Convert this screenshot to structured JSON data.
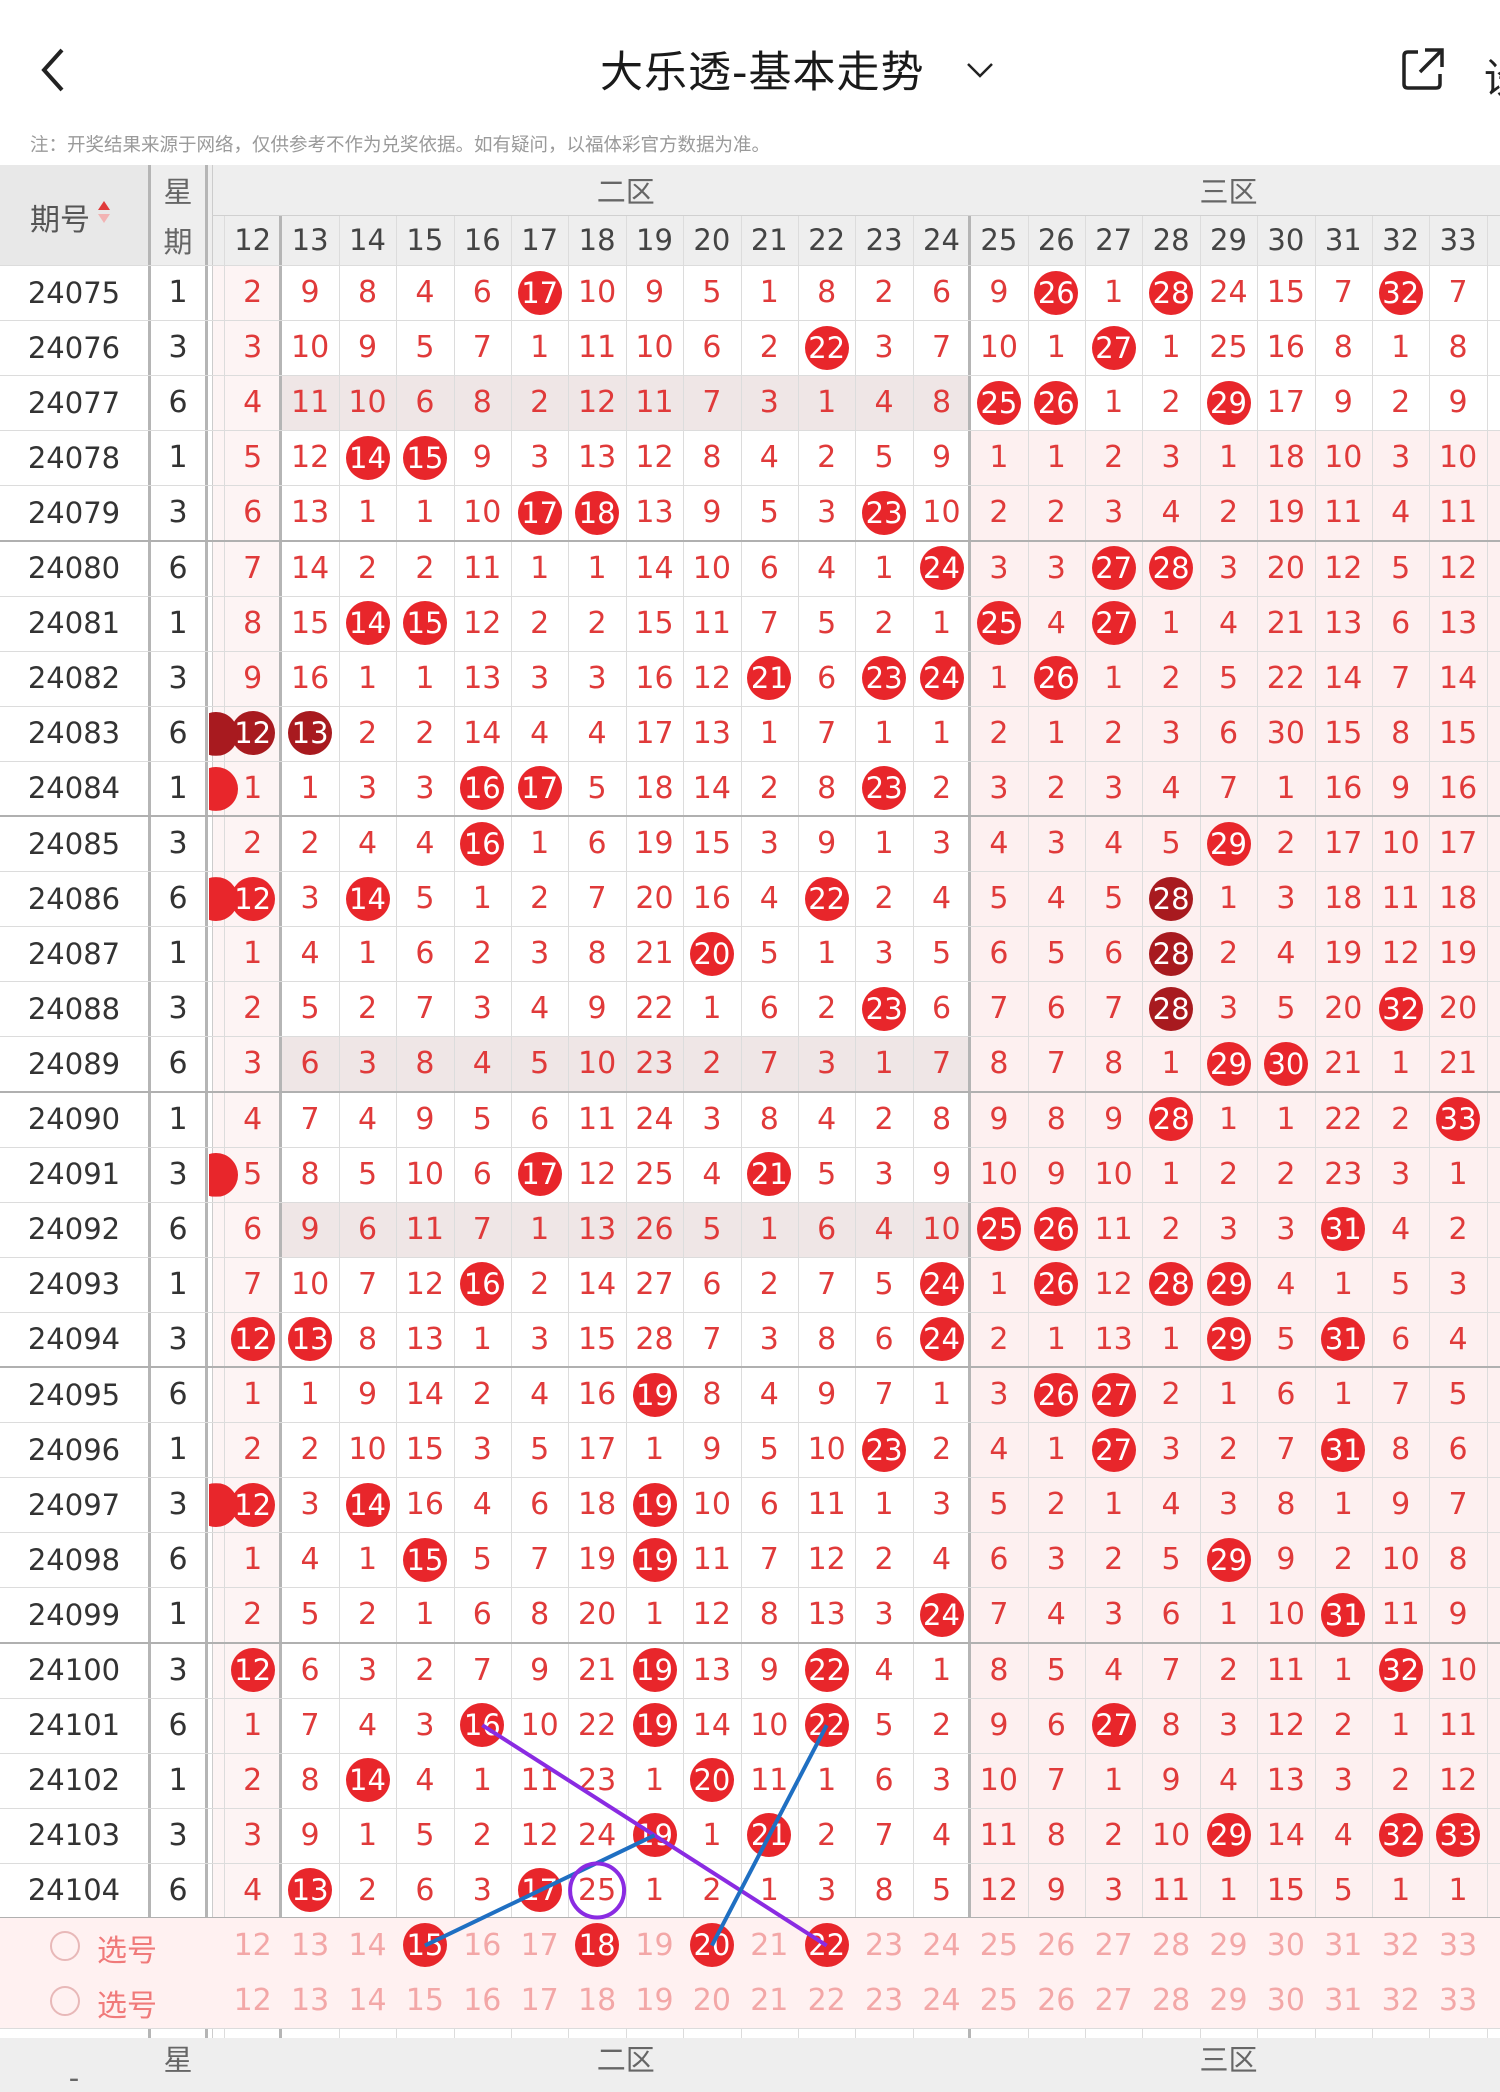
{
  "header": {
    "title": "大乐透-基本走势",
    "cut_text": "设"
  },
  "notice": "注：开奖结果来源于网络，仅供参考不作为兑奖依据。如有疑问，以福体彩官方数据为准。",
  "table": {
    "issue_header": "期号",
    "week_header_top": "星",
    "week_header_bottom": "期",
    "zone_two": "二区",
    "zone_three": "三区",
    "columns": [
      "12",
      "13",
      "14",
      "15",
      "16",
      "17",
      "18",
      "19",
      "20",
      "21",
      "22",
      "23",
      "24",
      "25",
      "26",
      "27",
      "28",
      "29",
      "30",
      "31",
      "32",
      "33"
    ],
    "rows": [
      {
        "issue": "24075",
        "week": "1",
        "vals": [
          "2",
          "9",
          "8",
          "4",
          "6",
          "17",
          "10",
          "9",
          "5",
          "1",
          "8",
          "2",
          "6",
          "9",
          "26",
          "1",
          "28",
          "24",
          "15",
          "7",
          "32",
          "7"
        ]
      },
      {
        "issue": "24076",
        "week": "3",
        "vals": [
          "3",
          "10",
          "9",
          "5",
          "7",
          "1",
          "11",
          "10",
          "6",
          "2",
          "22",
          "3",
          "7",
          "10",
          "1",
          "27",
          "1",
          "25",
          "16",
          "8",
          "1",
          "8"
        ]
      },
      {
        "issue": "24077",
        "week": "6",
        "vals": [
          "4",
          "11",
          "10",
          "6",
          "8",
          "2",
          "12",
          "11",
          "7",
          "3",
          "1",
          "4",
          "8",
          "25",
          "26",
          "1",
          "2",
          "29",
          "17",
          "9",
          "2",
          "9"
        ]
      },
      {
        "issue": "24078",
        "week": "1",
        "vals": [
          "5",
          "12",
          "14",
          "15",
          "9",
          "3",
          "13",
          "12",
          "8",
          "4",
          "2",
          "5",
          "9",
          "1",
          "1",
          "2",
          "3",
          "1",
          "18",
          "10",
          "3",
          "10"
        ]
      },
      {
        "issue": "24079",
        "week": "3",
        "vals": [
          "6",
          "13",
          "1",
          "1",
          "10",
          "17",
          "18",
          "13",
          "9",
          "5",
          "3",
          "23",
          "10",
          "2",
          "2",
          "3",
          "4",
          "2",
          "19",
          "11",
          "4",
          "11"
        ]
      },
      {
        "issue": "24080",
        "week": "6",
        "vals": [
          "7",
          "14",
          "2",
          "2",
          "11",
          "1",
          "1",
          "14",
          "10",
          "6",
          "4",
          "1",
          "24",
          "3",
          "3",
          "27",
          "28",
          "3",
          "20",
          "12",
          "5",
          "12"
        ]
      },
      {
        "issue": "24081",
        "week": "1",
        "vals": [
          "8",
          "15",
          "14",
          "15",
          "12",
          "2",
          "2",
          "15",
          "11",
          "7",
          "5",
          "2",
          "1",
          "25",
          "4",
          "27",
          "1",
          "4",
          "21",
          "13",
          "6",
          "13"
        ]
      },
      {
        "issue": "24082",
        "week": "3",
        "vals": [
          "9",
          "16",
          "1",
          "1",
          "13",
          "3",
          "3",
          "16",
          "12",
          "21",
          "6",
          "23",
          "24",
          "1",
          "26",
          "1",
          "2",
          "5",
          "22",
          "14",
          "7",
          "14"
        ]
      },
      {
        "issue": "24083",
        "week": "6",
        "vals": [
          "12",
          "13",
          "2",
          "2",
          "14",
          "4",
          "4",
          "17",
          "13",
          "1",
          "7",
          "1",
          "1",
          "2",
          "1",
          "2",
          "3",
          "6",
          "30",
          "15",
          "8",
          "15"
        ]
      },
      {
        "issue": "24084",
        "week": "1",
        "vals": [
          "1",
          "1",
          "3",
          "3",
          "16",
          "17",
          "5",
          "18",
          "14",
          "2",
          "8",
          "23",
          "2",
          "3",
          "2",
          "3",
          "4",
          "7",
          "1",
          "16",
          "9",
          "16"
        ]
      },
      {
        "issue": "24085",
        "week": "3",
        "vals": [
          "2",
          "2",
          "4",
          "4",
          "16",
          "1",
          "6",
          "19",
          "15",
          "3",
          "9",
          "1",
          "3",
          "4",
          "3",
          "4",
          "5",
          "29",
          "2",
          "17",
          "10",
          "17"
        ]
      },
      {
        "issue": "24086",
        "week": "6",
        "vals": [
          "12",
          "3",
          "14",
          "5",
          "1",
          "2",
          "7",
          "20",
          "16",
          "4",
          "22",
          "2",
          "4",
          "5",
          "4",
          "5",
          "28",
          "1",
          "3",
          "18",
          "11",
          "18"
        ]
      },
      {
        "issue": "24087",
        "week": "1",
        "vals": [
          "1",
          "4",
          "1",
          "6",
          "2",
          "3",
          "8",
          "21",
          "20",
          "5",
          "1",
          "3",
          "5",
          "6",
          "5",
          "6",
          "28",
          "2",
          "4",
          "19",
          "12",
          "19"
        ]
      },
      {
        "issue": "24088",
        "week": "3",
        "vals": [
          "2",
          "5",
          "2",
          "7",
          "3",
          "4",
          "9",
          "22",
          "1",
          "6",
          "2",
          "23",
          "6",
          "7",
          "6",
          "7",
          "28",
          "3",
          "5",
          "20",
          "32",
          "20"
        ]
      },
      {
        "issue": "24089",
        "week": "6",
        "vals": [
          "3",
          "6",
          "3",
          "8",
          "4",
          "5",
          "10",
          "23",
          "2",
          "7",
          "3",
          "1",
          "7",
          "8",
          "7",
          "8",
          "1",
          "29",
          "30",
          "21",
          "1",
          "21"
        ]
      },
      {
        "issue": "24090",
        "week": "1",
        "vals": [
          "4",
          "7",
          "4",
          "9",
          "5",
          "6",
          "11",
          "24",
          "3",
          "8",
          "4",
          "2",
          "8",
          "9",
          "8",
          "9",
          "28",
          "1",
          "1",
          "22",
          "2",
          "33"
        ]
      },
      {
        "issue": "24091",
        "week": "3",
        "vals": [
          "5",
          "8",
          "5",
          "10",
          "6",
          "17",
          "12",
          "25",
          "4",
          "21",
          "5",
          "3",
          "9",
          "10",
          "9",
          "10",
          "1",
          "2",
          "2",
          "23",
          "3",
          "1"
        ]
      },
      {
        "issue": "24092",
        "week": "6",
        "vals": [
          "6",
          "9",
          "6",
          "11",
          "7",
          "1",
          "13",
          "26",
          "5",
          "1",
          "6",
          "4",
          "10",
          "25",
          "26",
          "11",
          "2",
          "3",
          "3",
          "31",
          "4",
          "2"
        ]
      },
      {
        "issue": "24093",
        "week": "1",
        "vals": [
          "7",
          "10",
          "7",
          "12",
          "16",
          "2",
          "14",
          "27",
          "6",
          "2",
          "7",
          "5",
          "24",
          "1",
          "26",
          "12",
          "28",
          "29",
          "4",
          "1",
          "5",
          "3"
        ]
      },
      {
        "issue": "24094",
        "week": "3",
        "vals": [
          "12",
          "13",
          "8",
          "13",
          "1",
          "3",
          "15",
          "28",
          "7",
          "3",
          "8",
          "6",
          "24",
          "2",
          "1",
          "13",
          "1",
          "29",
          "5",
          "31",
          "6",
          "4"
        ]
      },
      {
        "issue": "24095",
        "week": "6",
        "vals": [
          "1",
          "1",
          "9",
          "14",
          "2",
          "4",
          "16",
          "19",
          "8",
          "4",
          "9",
          "7",
          "1",
          "3",
          "26",
          "27",
          "2",
          "1",
          "6",
          "1",
          "7",
          "5"
        ]
      },
      {
        "issue": "24096",
        "week": "1",
        "vals": [
          "2",
          "2",
          "10",
          "15",
          "3",
          "5",
          "17",
          "1",
          "9",
          "5",
          "10",
          "23",
          "2",
          "4",
          "1",
          "27",
          "3",
          "2",
          "7",
          "31",
          "8",
          "6"
        ]
      },
      {
        "issue": "24097",
        "week": "3",
        "vals": [
          "12",
          "3",
          "14",
          "16",
          "4",
          "6",
          "18",
          "19",
          "10",
          "6",
          "11",
          "1",
          "3",
          "5",
          "2",
          "1",
          "4",
          "3",
          "8",
          "1",
          "9",
          "7"
        ]
      },
      {
        "issue": "24098",
        "week": "6",
        "vals": [
          "1",
          "4",
          "1",
          "15",
          "5",
          "7",
          "19",
          "19",
          "11",
          "7",
          "12",
          "2",
          "4",
          "6",
          "3",
          "2",
          "5",
          "29",
          "9",
          "2",
          "10",
          "8"
        ]
      },
      {
        "issue": "24099",
        "week": "1",
        "vals": [
          "2",
          "5",
          "2",
          "1",
          "6",
          "8",
          "20",
          "1",
          "12",
          "8",
          "13",
          "3",
          "24",
          "7",
          "4",
          "3",
          "6",
          "1",
          "10",
          "31",
          "11",
          "9"
        ]
      },
      {
        "issue": "24100",
        "week": "3",
        "vals": [
          "12",
          "6",
          "3",
          "2",
          "7",
          "9",
          "21",
          "19",
          "13",
          "9",
          "22",
          "4",
          "1",
          "8",
          "5",
          "4",
          "7",
          "2",
          "11",
          "1",
          "32",
          "10"
        ]
      },
      {
        "issue": "24101",
        "week": "6",
        "vals": [
          "1",
          "7",
          "4",
          "3",
          "16",
          "10",
          "22",
          "19",
          "14",
          "10",
          "22",
          "5",
          "2",
          "9",
          "6",
          "27",
          "8",
          "3",
          "12",
          "2",
          "1",
          "11"
        ]
      },
      {
        "issue": "24102",
        "week": "1",
        "vals": [
          "2",
          "8",
          "14",
          "4",
          "1",
          "11",
          "23",
          "1",
          "20",
          "11",
          "1",
          "6",
          "3",
          "10",
          "7",
          "1",
          "9",
          "4",
          "13",
          "3",
          "2",
          "12"
        ]
      },
      {
        "issue": "24103",
        "week": "3",
        "vals": [
          "3",
          "9",
          "1",
          "5",
          "2",
          "12",
          "24",
          "19",
          "1",
          "21",
          "2",
          "7",
          "4",
          "11",
          "8",
          "2",
          "10",
          "29",
          "14",
          "4",
          "32",
          "33"
        ]
      },
      {
        "issue": "24104",
        "week": "6",
        "vals": [
          "4",
          "13",
          "2",
          "6",
          "3",
          "17",
          "25",
          "1",
          "2",
          "1",
          "3",
          "8",
          "5",
          "12",
          "9",
          "3",
          "11",
          "1",
          "15",
          "5",
          "1",
          "1"
        ]
      }
    ],
    "select_label": "选号"
  },
  "colors": {
    "ball_red": "#e8262b",
    "ball_dark": "#a81a1f",
    "text_red": "#e03a3a",
    "grid_line": "#dcdcdc",
    "pink_bg": "#fdf0f0",
    "band_bg": "#efe6e6",
    "purple_mark": "#8a2be2",
    "blue_line": "#1f6fc2"
  },
  "icons": [
    "back-arrow-icon",
    "chevron-down-icon",
    "share-icon",
    "sort-icon",
    "radio-icon"
  ]
}
